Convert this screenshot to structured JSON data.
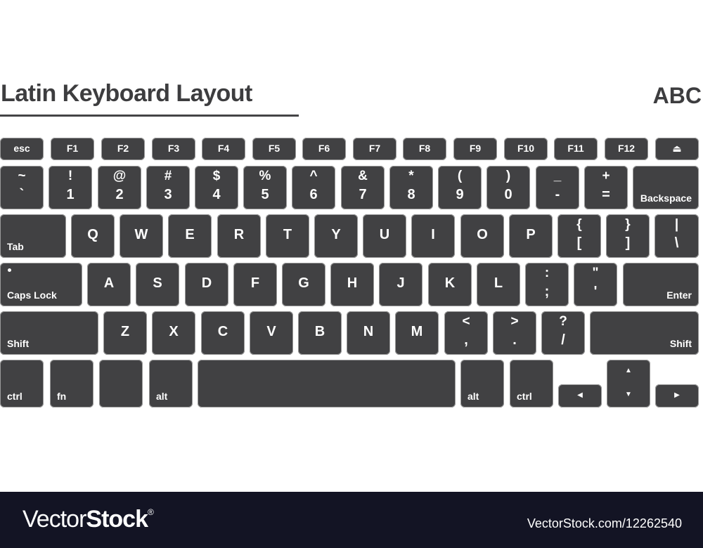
{
  "header": {
    "title": "Latin Keyboard Layout",
    "layout_code": "ABC"
  },
  "keyboard": {
    "key_color": "#414143",
    "function_row": [
      "esc",
      "F1",
      "F2",
      "F3",
      "F4",
      "F5",
      "F6",
      "F7",
      "F8",
      "F9",
      "F10",
      "F11",
      "F12"
    ],
    "eject_icon": "⏏",
    "number_row": [
      {
        "top": "~",
        "bottom": "`"
      },
      {
        "top": "!",
        "bottom": "1"
      },
      {
        "top": "@",
        "bottom": "2"
      },
      {
        "top": "#",
        "bottom": "3"
      },
      {
        "top": "$",
        "bottom": "4"
      },
      {
        "top": "%",
        "bottom": "5"
      },
      {
        "top": "^",
        "bottom": "6"
      },
      {
        "top": "&",
        "bottom": "7"
      },
      {
        "top": "*",
        "bottom": "8"
      },
      {
        "top": "(",
        "bottom": "9"
      },
      {
        "top": ")",
        "bottom": "0"
      },
      {
        "top": "_",
        "bottom": "-"
      },
      {
        "top": "+",
        "bottom": "="
      }
    ],
    "backspace": "Backspace",
    "tab": "Tab",
    "qwerty_row": [
      "Q",
      "W",
      "E",
      "R",
      "T",
      "Y",
      "U",
      "I",
      "O",
      "P"
    ],
    "qwerty_symbols": [
      {
        "top": "{",
        "bottom": "["
      },
      {
        "top": "}",
        "bottom": "]"
      },
      {
        "top": "|",
        "bottom": "\\"
      }
    ],
    "caps_lock": "Caps Lock",
    "home_row": [
      "A",
      "S",
      "D",
      "F",
      "G",
      "H",
      "J",
      "K",
      "L"
    ],
    "home_symbols": [
      {
        "top": ":",
        "bottom": ";"
      },
      {
        "top": "\"",
        "bottom": "'"
      }
    ],
    "enter": "Enter",
    "shift_left": "Shift",
    "shift_row": [
      "Z",
      "X",
      "C",
      "V",
      "B",
      "N",
      "M"
    ],
    "shift_symbols": [
      {
        "top": "<",
        "bottom": ","
      },
      {
        "top": ">",
        "bottom": "."
      },
      {
        "top": "?",
        "bottom": "/"
      }
    ],
    "shift_right": "Shift",
    "bottom_row": {
      "ctrl_left": "ctrl",
      "fn": "fn",
      "alt_left": "alt",
      "alt_right": "alt",
      "ctrl_right": "ctrl"
    },
    "arrows": {
      "left": "◀",
      "up": "▲",
      "down": "▼",
      "right": "▶"
    }
  },
  "footer": {
    "brand_light": "Vector",
    "brand_bold": "Stock",
    "brand_mark": "®",
    "stock_id": "VectorStock.com/12262540"
  }
}
